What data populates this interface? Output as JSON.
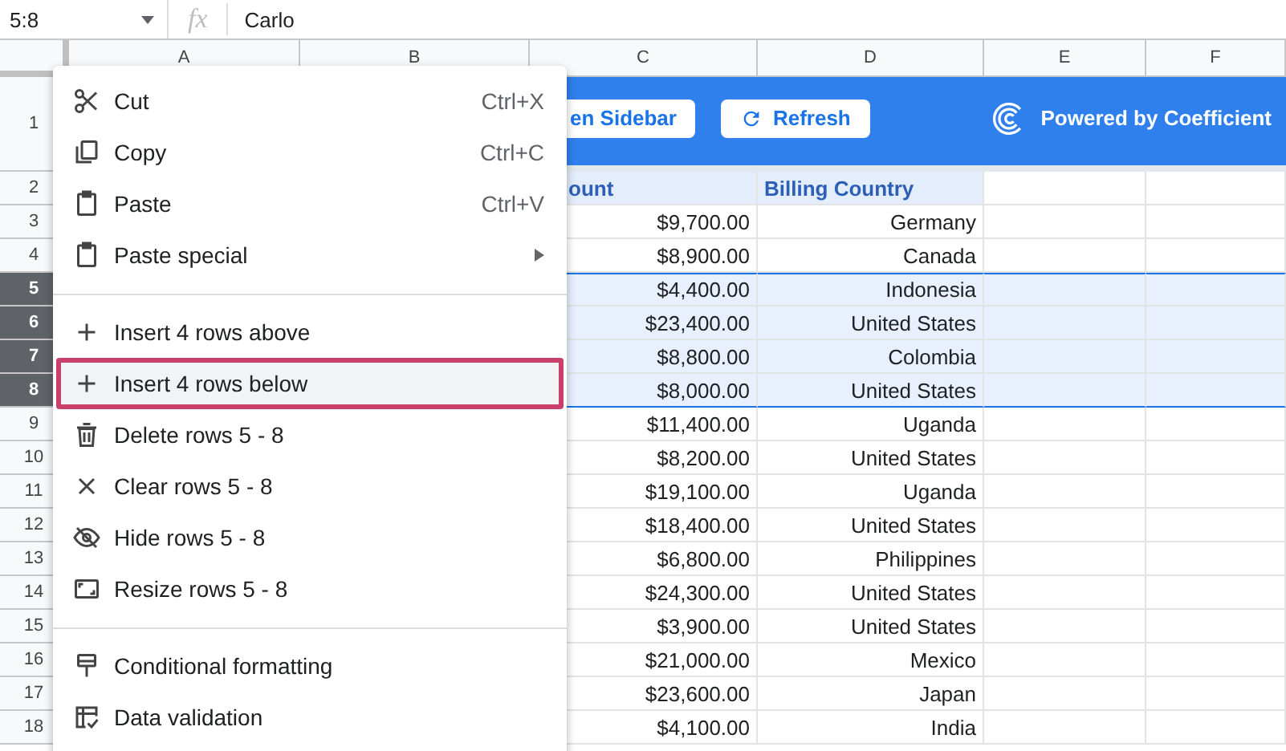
{
  "formula_bar": {
    "name_box": "5:8",
    "fx": "fx",
    "value": "Carlo"
  },
  "columns": [
    "A",
    "B",
    "C",
    "D",
    "E",
    "F"
  ],
  "banner": {
    "buttons": [
      {
        "label": "en Sidebar"
      },
      {
        "label": "Refresh"
      }
    ],
    "brand": "Powered by Coefficient"
  },
  "row_numbers": [
    {
      "label": "1",
      "selected": false
    },
    {
      "label": "2",
      "selected": false
    },
    {
      "label": "3",
      "selected": false
    },
    {
      "label": "4",
      "selected": false
    },
    {
      "label": "5",
      "selected": true
    },
    {
      "label": "6",
      "selected": true
    },
    {
      "label": "7",
      "selected": true
    },
    {
      "label": "8",
      "selected": true
    },
    {
      "label": "9",
      "selected": false
    },
    {
      "label": "10",
      "selected": false
    },
    {
      "label": "11",
      "selected": false
    },
    {
      "label": "12",
      "selected": false
    },
    {
      "label": "13",
      "selected": false
    },
    {
      "label": "14",
      "selected": false
    },
    {
      "label": "15",
      "selected": false
    },
    {
      "label": "16",
      "selected": false
    },
    {
      "label": "17",
      "selected": false
    },
    {
      "label": "18",
      "selected": false
    }
  ],
  "table": {
    "header": [
      "ount",
      "Billing Country"
    ],
    "rows": [
      {
        "amount": "$9,700.00",
        "country": "Germany"
      },
      {
        "amount": "$8,900.00",
        "country": "Canada"
      },
      {
        "amount": "$4,400.00",
        "country": "Indonesia"
      },
      {
        "amount": "$23,400.00",
        "country": "United States"
      },
      {
        "amount": "$8,800.00",
        "country": "Colombia"
      },
      {
        "amount": "$8,000.00",
        "country": "United States"
      },
      {
        "amount": "$11,400.00",
        "country": "Uganda"
      },
      {
        "amount": "$8,200.00",
        "country": "United States"
      },
      {
        "amount": "$19,100.00",
        "country": "Uganda"
      },
      {
        "amount": "$18,400.00",
        "country": "United States"
      },
      {
        "amount": "$6,800.00",
        "country": "Philippines"
      },
      {
        "amount": "$24,300.00",
        "country": "United States"
      },
      {
        "amount": "$3,900.00",
        "country": "United States"
      },
      {
        "amount": "$21,000.00",
        "country": "Mexico"
      },
      {
        "amount": "$23,600.00",
        "country": "Japan"
      },
      {
        "amount": "$4,100.00",
        "country": "India"
      }
    ]
  },
  "context_menu": {
    "groups": [
      [
        {
          "label": "Cut",
          "shortcut": "Ctrl+X",
          "submenu": false,
          "selected": false
        },
        {
          "label": "Copy",
          "shortcut": "Ctrl+C",
          "submenu": false,
          "selected": false
        },
        {
          "label": "Paste",
          "shortcut": "Ctrl+V",
          "submenu": false,
          "selected": false
        },
        {
          "label": "Paste special",
          "submenu": true,
          "selected": false
        }
      ],
      [
        {
          "label": "Insert 4 rows above",
          "submenu": false,
          "selected": false
        },
        {
          "label": "Insert 4 rows below",
          "submenu": false,
          "selected": true
        },
        {
          "label": "Delete rows 5 - 8",
          "submenu": false,
          "selected": false
        },
        {
          "label": "Clear rows 5 - 8",
          "submenu": false,
          "selected": false
        },
        {
          "label": "Hide rows 5 - 8",
          "submenu": false,
          "selected": false
        },
        {
          "label": "Resize rows 5 - 8",
          "submenu": false,
          "selected": false
        }
      ],
      [
        {
          "label": "Conditional formatting",
          "submenu": false,
          "selected": false
        },
        {
          "label": "Data validation",
          "submenu": false,
          "selected": false
        }
      ]
    ]
  }
}
